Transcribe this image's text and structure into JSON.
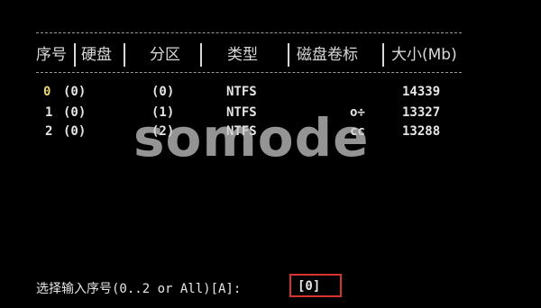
{
  "table": {
    "headers": {
      "index": "序号",
      "disk": "硬盘",
      "partition": "分区",
      "type": "类型",
      "label": "磁盘卷标",
      "size": "大小(Mb)"
    },
    "rows": [
      {
        "index": "0",
        "disk": "(0)",
        "partition": "(0)",
        "type": "NTFS",
        "label": "",
        "size": "14339"
      },
      {
        "index": "1",
        "disk": "(0)",
        "partition": "(1)",
        "type": "NTFS",
        "label": "o÷",
        "size": "13327"
      },
      {
        "index": "2",
        "disk": "(0)",
        "partition": "(2)",
        "type": "NTFS",
        "label": "cc",
        "size": "13288"
      }
    ]
  },
  "prompt": {
    "text": "选择输入序号(0..2 or All)[A]:",
    "value": "[0]"
  },
  "watermark": "somode",
  "colors": {
    "background": "#000000",
    "text": "#e6e6e6",
    "selected_index": "#e8d76a",
    "input_highlight": "#d8342d"
  }
}
